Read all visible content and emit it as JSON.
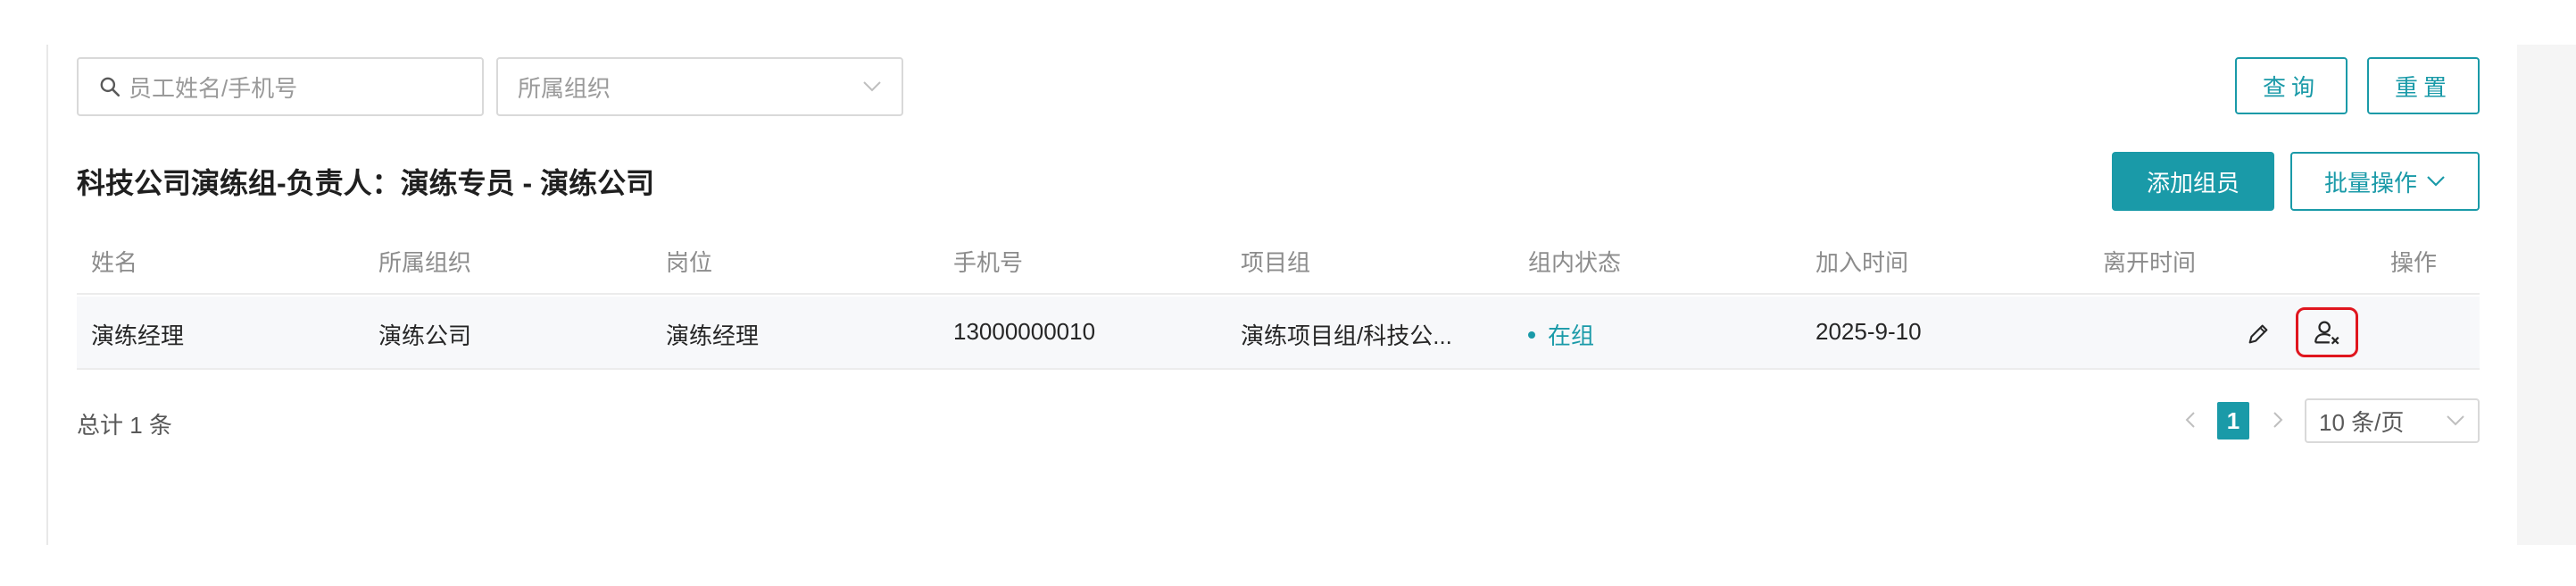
{
  "search": {
    "placeholder": "员工姓名/手机号",
    "org_placeholder": "所属组织",
    "query_label": "查询",
    "reset_label": "重置"
  },
  "group": {
    "title": "科技公司演练组-负责人：演练专员 - 演练公司",
    "add_label": "添加组员",
    "batch_label": "批量操作"
  },
  "table": {
    "headers": [
      "姓名",
      "所属组织",
      "岗位",
      "手机号",
      "项目组",
      "组内状态",
      "加入时间",
      "离开时间",
      "操作"
    ],
    "rows": [
      {
        "name": "演练经理",
        "org": "演练公司",
        "position": "演练经理",
        "phone": "13000000010",
        "project": "演练项目组/科技公...",
        "status": "在组",
        "join_time": "2025-9-10",
        "leave_time": ""
      }
    ]
  },
  "footer": {
    "total": "总计 1 条",
    "current_page": "1",
    "page_size": "10 条/页"
  },
  "colors": {
    "accent": "#1a9aa8",
    "highlight": "#e0161e"
  }
}
